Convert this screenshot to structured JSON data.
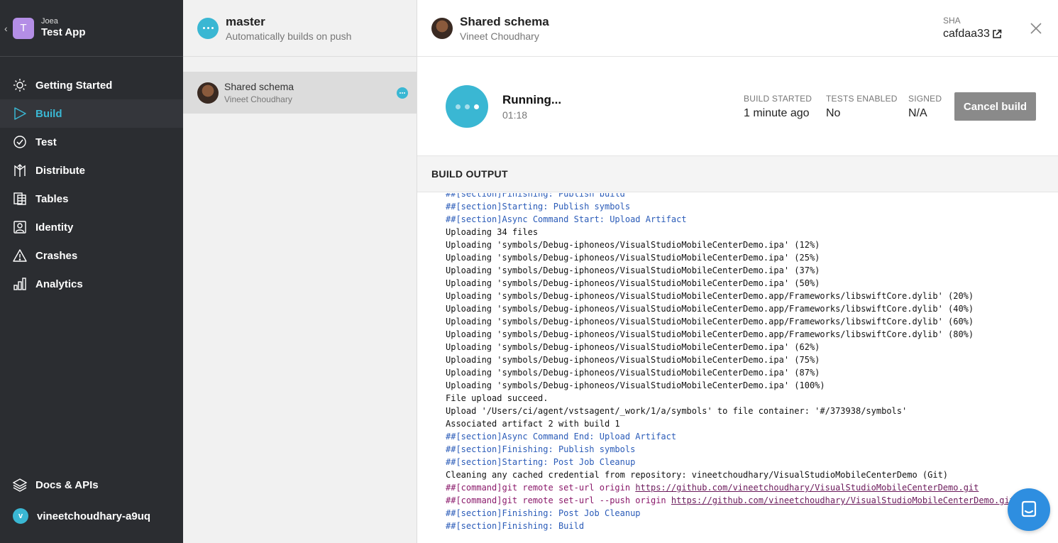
{
  "sidebar": {
    "app_owner": "Joea",
    "app_name": "Test App",
    "app_initial": "T",
    "items": [
      {
        "label": "Getting Started",
        "icon": "sun-icon"
      },
      {
        "label": "Build",
        "icon": "play-icon"
      },
      {
        "label": "Test",
        "icon": "check-circle-icon"
      },
      {
        "label": "Distribute",
        "icon": "distribute-icon"
      },
      {
        "label": "Tables",
        "icon": "tables-icon"
      },
      {
        "label": "Identity",
        "icon": "identity-icon"
      },
      {
        "label": "Crashes",
        "icon": "warning-icon"
      },
      {
        "label": "Analytics",
        "icon": "bar-chart-icon"
      }
    ],
    "active_item": "Build",
    "docs_label": "Docs & APIs",
    "user_name": "vineetchoudhary-a9uq",
    "user_initial": "v"
  },
  "branch": {
    "name": "master",
    "subtitle": "Automatically builds on push"
  },
  "build_list": [
    {
      "title": "Shared schema",
      "author": "Vineet Choudhary"
    }
  ],
  "commit": {
    "title": "Shared schema",
    "author": "Vineet Choudhary",
    "sha_label": "SHA",
    "sha_value": "cafdaa33"
  },
  "status": {
    "label": "Running...",
    "elapsed": "01:18",
    "build_started_label": "BUILD STARTED",
    "build_started_value": "1 minute ago",
    "tests_label": "TESTS ENABLED",
    "tests_value": "No",
    "signed_label": "SIGNED",
    "signed_value": "N/A",
    "cancel_label": "Cancel build"
  },
  "output": {
    "header": "BUILD OUTPUT",
    "lines": [
      {
        "type": "section",
        "text": "##[section]Finishing: Publish build"
      },
      {
        "type": "section",
        "text": "##[section]Starting: Publish symbols"
      },
      {
        "type": "section",
        "text": "##[section]Async Command Start: Upload Artifact"
      },
      {
        "type": "plain",
        "text": "Uploading 34 files"
      },
      {
        "type": "plain",
        "text": "Uploading 'symbols/Debug-iphoneos/VisualStudioMobileCenterDemo.ipa' (12%)"
      },
      {
        "type": "plain",
        "text": "Uploading 'symbols/Debug-iphoneos/VisualStudioMobileCenterDemo.ipa' (25%)"
      },
      {
        "type": "plain",
        "text": "Uploading 'symbols/Debug-iphoneos/VisualStudioMobileCenterDemo.ipa' (37%)"
      },
      {
        "type": "plain",
        "text": "Uploading 'symbols/Debug-iphoneos/VisualStudioMobileCenterDemo.ipa' (50%)"
      },
      {
        "type": "plain",
        "text": "Uploading 'symbols/Debug-iphoneos/VisualStudioMobileCenterDemo.app/Frameworks/libswiftCore.dylib' (20%)"
      },
      {
        "type": "plain",
        "text": "Uploading 'symbols/Debug-iphoneos/VisualStudioMobileCenterDemo.app/Frameworks/libswiftCore.dylib' (40%)"
      },
      {
        "type": "plain",
        "text": "Uploading 'symbols/Debug-iphoneos/VisualStudioMobileCenterDemo.app/Frameworks/libswiftCore.dylib' (60%)"
      },
      {
        "type": "plain",
        "text": "Uploading 'symbols/Debug-iphoneos/VisualStudioMobileCenterDemo.app/Frameworks/libswiftCore.dylib' (80%)"
      },
      {
        "type": "plain",
        "text": "Uploading 'symbols/Debug-iphoneos/VisualStudioMobileCenterDemo.ipa' (62%)"
      },
      {
        "type": "plain",
        "text": "Uploading 'symbols/Debug-iphoneos/VisualStudioMobileCenterDemo.ipa' (75%)"
      },
      {
        "type": "plain",
        "text": "Uploading 'symbols/Debug-iphoneos/VisualStudioMobileCenterDemo.ipa' (87%)"
      },
      {
        "type": "plain",
        "text": "Uploading 'symbols/Debug-iphoneos/VisualStudioMobileCenterDemo.ipa' (100%)"
      },
      {
        "type": "plain",
        "text": "File upload succeed."
      },
      {
        "type": "plain",
        "text": "Upload '/Users/ci/agent/vstsagent/_work/1/a/symbols' to file container: '#/373938/symbols'"
      },
      {
        "type": "plain",
        "text": "Associated artifact 2 with build 1"
      },
      {
        "type": "section",
        "text": "##[section]Async Command End: Upload Artifact"
      },
      {
        "type": "section",
        "text": "##[section]Finishing: Publish symbols"
      },
      {
        "type": "section",
        "text": "##[section]Starting: Post Job Cleanup"
      },
      {
        "type": "plain",
        "text": "Cleaning any cached credential from repository: vineetchoudhary/VisualStudioMobileCenterDemo (Git)"
      },
      {
        "type": "command",
        "text": "##[command]git remote set-url origin ",
        "link": "https://github.com/vineetchoudhary/VisualStudioMobileCenterDemo.git"
      },
      {
        "type": "command",
        "text": "##[command]git remote set-url --push origin ",
        "link": "https://github.com/vineetchoudhary/VisualStudioMobileCenterDemo.git"
      },
      {
        "type": "section",
        "text": "##[section]Finishing: Post Job Cleanup"
      },
      {
        "type": "section",
        "text": "##[section]Finishing: Build"
      }
    ]
  },
  "colors": {
    "accent": "#3ab7d3",
    "sidebar_bg": "#2b2d31",
    "section_text": "#2a5bb8",
    "command_text": "#8b1a6b",
    "chat_bubble": "#2e8ee0"
  }
}
